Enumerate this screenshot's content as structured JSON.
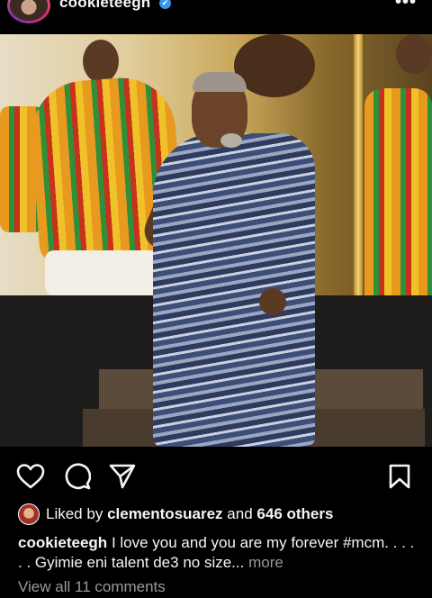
{
  "header": {
    "username": "cookieteegh",
    "verified_glyph": "✔",
    "more_glyph": "•••"
  },
  "post": {
    "image_alt": "performer in blue kente cloth on stage before people in colourful kente"
  },
  "actions": {
    "icons": [
      "heart-icon",
      "comment-icon",
      "share-icon",
      "save-icon"
    ]
  },
  "likes": {
    "prefix": "Liked by",
    "user": "clementosuarez",
    "connector": "and",
    "others": "646 others"
  },
  "caption": {
    "username": "cookieteegh",
    "text": "I love you and you are my forever #mcm. . . . . . Gyimie eni talent de3 no size...",
    "more_label": "more"
  },
  "comments": {
    "view_all_label": "View all 11 comments"
  },
  "colors": {
    "background": "#000000",
    "text": "#f5f5f5",
    "muted": "#9a9a9a",
    "verified": "#3897f0"
  }
}
